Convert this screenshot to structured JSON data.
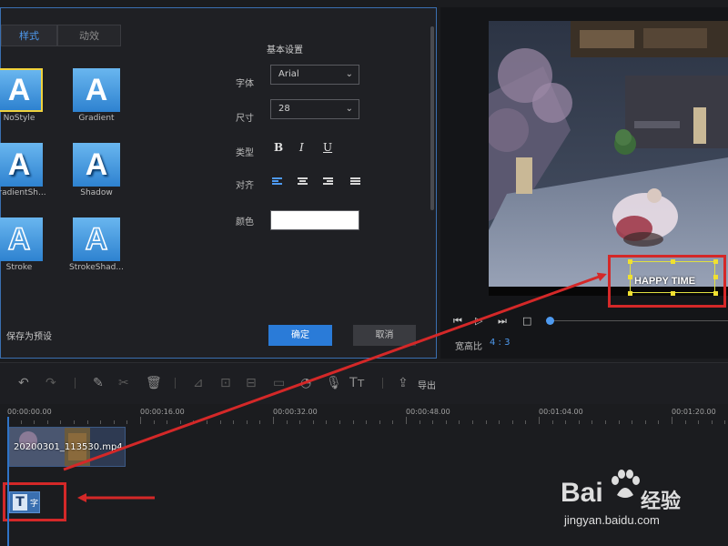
{
  "dialog": {
    "tabs": [
      "样式",
      "动效"
    ],
    "styles": [
      {
        "label": "NoStyle",
        "selected": true
      },
      {
        "label": "Gradient"
      },
      {
        "label": "GradientSh..."
      },
      {
        "label": "Shadow"
      },
      {
        "label": "Stroke"
      },
      {
        "label": "StrokeShad..."
      }
    ],
    "basic_settings_title": "基本设置",
    "font_label": "字体",
    "font_value": "Arial",
    "size_label": "尺寸",
    "size_value": "28",
    "type_label": "类型",
    "bold": "B",
    "italic": "I",
    "underline": "U",
    "align_label": "对齐",
    "color_label": "颜色",
    "color_value": "#ffffff",
    "save_preset": "保存为预设",
    "ok": "确定",
    "cancel": "取消"
  },
  "preview": {
    "caption": "HAPPY TIME",
    "aspect_label": "宽高比",
    "aspect_value": "4 : 3"
  },
  "toolbar": {
    "export": "导出"
  },
  "timeline": {
    "ruler": [
      "00:00:00.00",
      "00:00:16.00",
      "00:00:32.00",
      "00:00:48.00",
      "00:01:04.00",
      "00:01:20.00"
    ],
    "clip_name": "20200301_113530.mp4",
    "text_clip_char": "字"
  },
  "watermark": {
    "logo": "Bai",
    "logo2": "经验",
    "url": "jingyan.baidu.com"
  },
  "colors": {
    "accent": "#2a7bd8",
    "annotation": "#d42828",
    "style_tile": "#4a9ae4"
  }
}
